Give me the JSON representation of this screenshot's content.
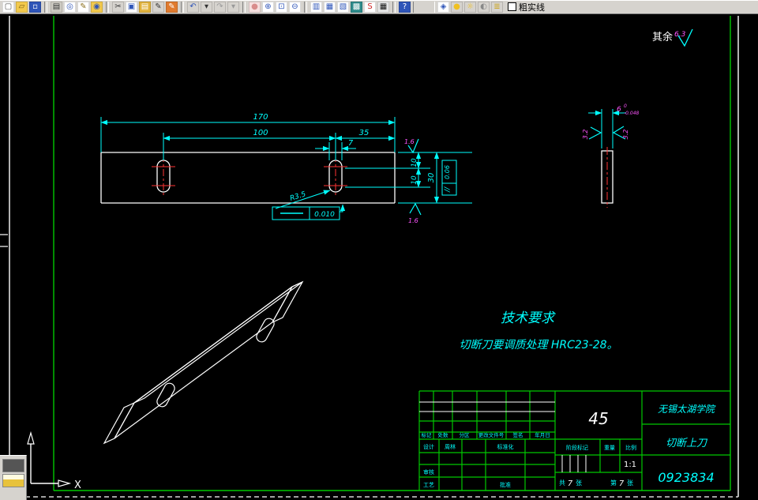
{
  "toolbar": {
    "items": [
      {
        "n": "new-file",
        "g": "▢",
        "fg": "#555555",
        "bg": "#ffffff"
      },
      {
        "n": "open-file",
        "g": "▱",
        "fg": "#7a5c10",
        "bg": "#f2c94c"
      },
      {
        "n": "save-file",
        "g": "▫",
        "fg": "#ffffff",
        "bg": "#2f55b8"
      },
      {
        "t": "sep"
      },
      {
        "n": "print",
        "g": "▤",
        "fg": "#333333",
        "bg": "#cfccc4"
      },
      {
        "n": "print-preview",
        "g": "◎",
        "fg": "#2f55b8",
        "bg": "#ffffff"
      },
      {
        "n": "plot-style",
        "g": "✎",
        "fg": "#8a6d1a",
        "bg": "#ffffff"
      },
      {
        "n": "publish-web",
        "g": "◉",
        "fg": "#2f55b8",
        "bg": "#f2c94c"
      },
      {
        "t": "sep"
      },
      {
        "n": "cut",
        "g": "✂",
        "fg": "#333333",
        "bg": "#d6d3ce"
      },
      {
        "n": "copy",
        "g": "▣",
        "fg": "#2f55b8",
        "bg": "#ffffff"
      },
      {
        "n": "paste",
        "g": "▤",
        "fg": "#ffffff",
        "bg": "#e0b23c"
      },
      {
        "n": "match-properties",
        "g": "✎",
        "fg": "#333333",
        "bg": "#d6d3ce"
      },
      {
        "n": "edit-block",
        "g": "✎",
        "fg": "#ffffff",
        "bg": "#e07b2f"
      },
      {
        "t": "sep"
      },
      {
        "n": "undo",
        "g": "↶",
        "fg": "#2f55b8",
        "bg": "#d6d3ce"
      },
      {
        "n": "undo-dropdown",
        "g": "▾",
        "fg": "#333333",
        "bg": "#d6d3ce"
      },
      {
        "n": "redo",
        "g": "↷",
        "fg": "#9a9a9a",
        "bg": "#d6d3ce"
      },
      {
        "n": "redo-dropdown",
        "g": "▾",
        "fg": "#9a9a9a",
        "bg": "#d6d3ce"
      },
      {
        "t": "sep"
      },
      {
        "n": "pan",
        "g": "●",
        "fg": "#d98c8c",
        "bg": "#f6e0e0"
      },
      {
        "n": "zoom-realtime",
        "g": "⊕",
        "fg": "#2f55b8",
        "bg": "#ffffff"
      },
      {
        "n": "zoom-window",
        "g": "⊡",
        "fg": "#2f55b8",
        "bg": "#ffffff"
      },
      {
        "n": "zoom-previous",
        "g": "⊖",
        "fg": "#2f55b8",
        "bg": "#ffffff"
      },
      {
        "t": "sep"
      },
      {
        "n": "properties",
        "g": "▥",
        "fg": "#2f55b8",
        "bg": "#ffffff"
      },
      {
        "n": "sheet-set-manager",
        "g": "▦",
        "fg": "#2f55b8",
        "bg": "#ffffff"
      },
      {
        "n": "markup-set-manager",
        "g": "▧",
        "fg": "#2f55b8",
        "bg": "#ffffff"
      },
      {
        "n": "render",
        "g": "▩",
        "fg": "#ffffff",
        "bg": "#2e8b8b"
      },
      {
        "n": "block-attributes",
        "g": "S",
        "fg": "#cc2222",
        "bg": "#ffffff"
      },
      {
        "n": "quick-calc",
        "g": "▦",
        "fg": "#111111",
        "bg": "#e8e8e8"
      },
      {
        "t": "sep"
      },
      {
        "n": "help",
        "g": "?",
        "fg": "#ffffff",
        "bg": "#2f55b8"
      },
      {
        "t": "gap"
      },
      {
        "n": "layers",
        "g": "◈",
        "fg": "#2f55b8",
        "bg": "#ffffff"
      },
      {
        "n": "layer-on-bulb",
        "g": "●",
        "fg": "#f0c020",
        "bg": "#d6d3ce"
      },
      {
        "n": "layer-freeze-sun",
        "g": "☼",
        "fg": "#f0c020",
        "bg": "#d6d3ce"
      },
      {
        "n": "layer-plot",
        "g": "◐",
        "fg": "#888888",
        "bg": "#d6d3ce"
      },
      {
        "n": "layer-lock",
        "g": "≣",
        "fg": "#caa520",
        "bg": "#d6d3ce"
      }
    ],
    "layer_combo": {
      "label": "粗实线",
      "swatch_color": "#ffffff"
    }
  },
  "colors": {
    "canvas_bg": "#000000",
    "part_line": "#ffffff",
    "dimension": "#00ffff",
    "centerline": "#ff3333",
    "roughness_value": "#ff55ff",
    "table_green": "#00c800",
    "toolbar_bg": "#d6d3ce"
  },
  "drawing": {
    "surface_note": {
      "label": "其余",
      "value": "6.3"
    },
    "front_view": {
      "length": "170",
      "hole_span": "100",
      "edge_offset": "35",
      "slot_width": "7",
      "seg1": "10",
      "seg2": "10",
      "height": "30",
      "radius": "R3.5",
      "flatness_value": "0.010",
      "parallelism_symbol": "//",
      "parallelism_value": "0.06",
      "rough_top": "1.6",
      "rough_bottom": "1.6"
    },
    "side_view": {
      "thickness_main": "6",
      "thickness_upper": "0",
      "thickness_lower": "-0.048",
      "rough_left": "3.2",
      "rough_right": "3.2"
    },
    "tech_req": {
      "title": "技术要求",
      "line1": "切断刀要调质处理 HRC23-28。"
    },
    "ucs": {
      "x_label": "X"
    }
  },
  "title_block": {
    "material": "45",
    "organization": "无锡太湖学院",
    "part_name": "切断上刀",
    "drawing_number": "0923834",
    "stage_label": "阶段标记",
    "weight_label": "重量",
    "scale_label": "比例",
    "scale_value": "1:1",
    "sheet": {
      "total_prefix": "共",
      "total": "7",
      "total_suffix": "张",
      "page_prefix": "第",
      "page": "7",
      "page_suffix": "张"
    },
    "rev_headers": [
      "标记",
      "处数",
      "分区",
      "更改文件号",
      "签名",
      "年月日"
    ],
    "sign": {
      "design_label": "设计",
      "design_name": "周林",
      "standard_label": "标准化",
      "check_label": "审核",
      "process_label": "工艺",
      "approve_label": "批准"
    }
  }
}
